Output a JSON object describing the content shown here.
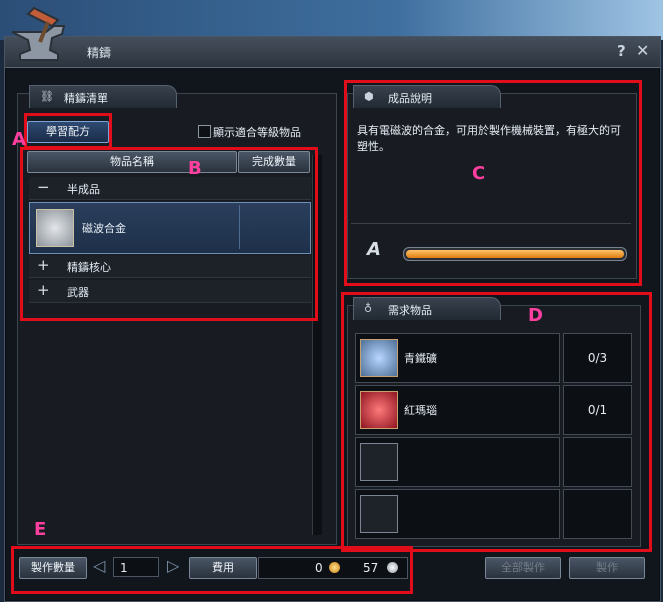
{
  "window": {
    "title": "精鑄",
    "help": "?",
    "close": "✕"
  },
  "left": {
    "header": "精鑄清單",
    "learn_button": "學習配方",
    "show_level_label": "顯示適合等級物品",
    "col_name": "物品名稱",
    "col_done": "完成數量",
    "rows": [
      {
        "sign": "−",
        "label": "半成品"
      },
      {
        "sign": "",
        "label": "磁波合金"
      },
      {
        "sign": "+",
        "label": "精鑄核心"
      },
      {
        "sign": "+",
        "label": "武器"
      }
    ]
  },
  "desc": {
    "header": "成品說明",
    "text": "具有電磁波的合金，可用於製作機械裝置，有極大的可塑性。",
    "grade": "A",
    "bar_fill": 1.0
  },
  "needs": {
    "header": "需求物品",
    "items": [
      {
        "name": "青鐵礦",
        "count": "0/3"
      },
      {
        "name": "紅瑪瑙",
        "count": "0/1"
      },
      {
        "name": "",
        "count": ""
      },
      {
        "name": "",
        "count": ""
      }
    ]
  },
  "footer": {
    "qty_button": "製作數量",
    "qty_value": "1",
    "fee_button": "費用",
    "fee_value": "0",
    "money_value": "57",
    "make_all_button": "全部製作",
    "make_button": "製作"
  },
  "annotations": {
    "a": "A",
    "b": "B",
    "c": "C",
    "d": "D",
    "e": "E"
  },
  "colors": {
    "highlight": "#e10d1a",
    "tag": "#ff3f9f",
    "bar": "#f39a1e"
  }
}
